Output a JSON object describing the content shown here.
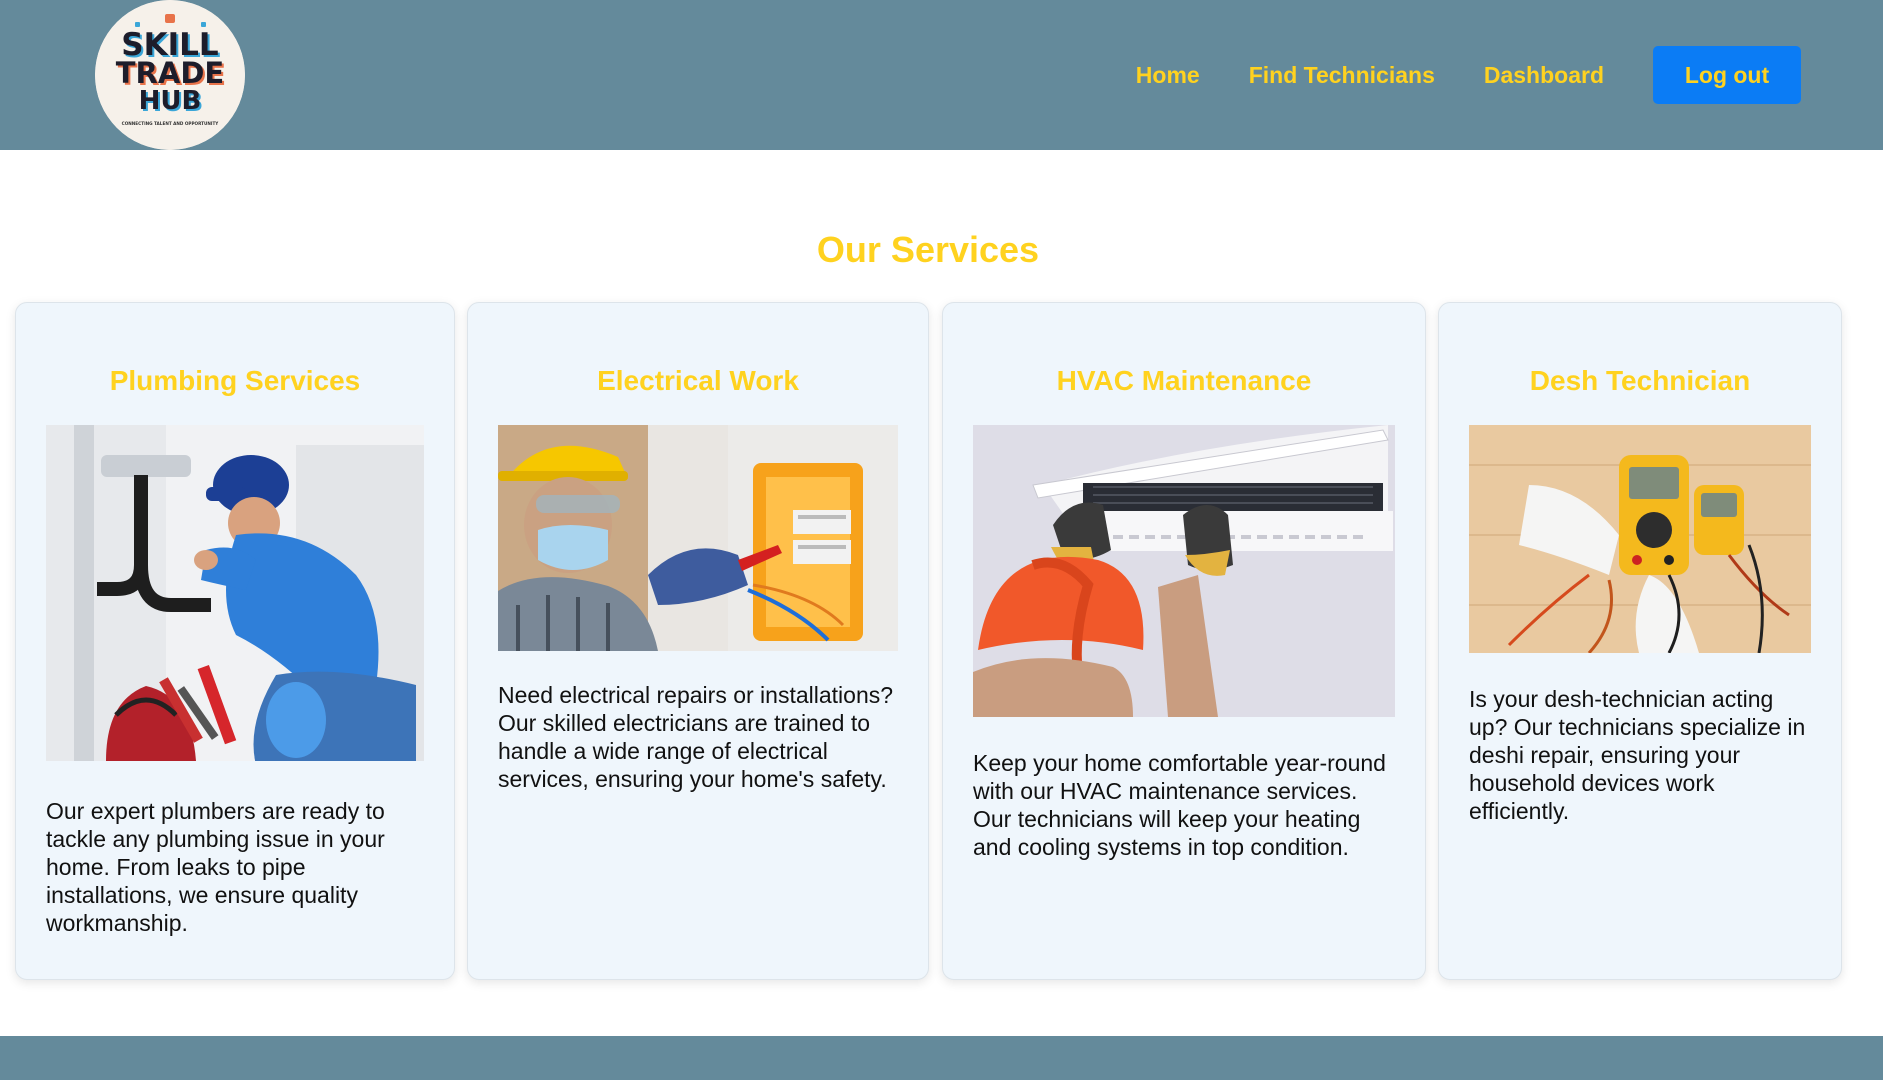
{
  "header": {
    "logo": {
      "icon": "skill-trade-hub-logo",
      "line1": "SKILL",
      "line2": "TRADE",
      "line3": "HUB",
      "tagline": "CONNECTING TALENT AND OPPORTUNITY"
    },
    "nav": {
      "home": "Home",
      "find_technicians": "Find Technicians",
      "dashboard": "Dashboard",
      "logout": "Log out"
    }
  },
  "colors": {
    "header_bg": "#648a9b",
    "accent_yellow": "#ffd21f",
    "button_blue": "#0b7cf5",
    "card_bg": "#eff6fc"
  },
  "services": {
    "title": "Our Services",
    "cards": [
      {
        "title": "Plumbing Services",
        "image": "plumber-under-sink-photo",
        "description": "Our expert plumbers are ready to tackle any plumbing issue in your home. From leaks to pipe installations, we ensure quality workmanship."
      },
      {
        "title": "Electrical Work",
        "image": "electrician-fuse-box-photo",
        "description": "Need electrical repairs or installations? Our skilled electricians are trained to handle a wide range of electrical services, ensuring your home's safety."
      },
      {
        "title": "HVAC Maintenance",
        "image": "ac-technician-photo",
        "description": "Keep your home comfortable year-round with our HVAC maintenance services. Our technicians will keep your heating and cooling systems in top condition."
      },
      {
        "title": "Desh Technician",
        "image": "multimeter-photo",
        "description": "Is your desh-technician acting up? Our technicians specialize in deshi repair, ensuring your household devices work efficiently."
      }
    ]
  }
}
